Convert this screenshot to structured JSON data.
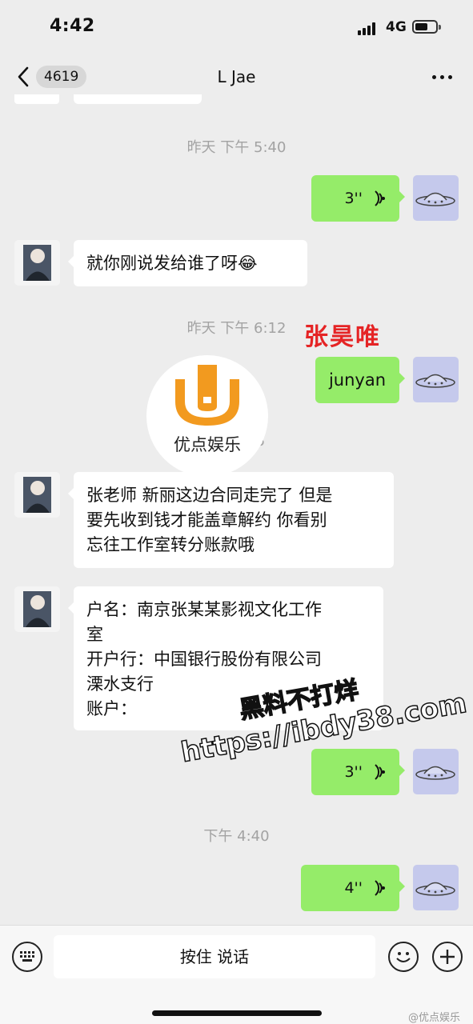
{
  "status_bar": {
    "time": "4:42",
    "network": "4G"
  },
  "header": {
    "unread_count": "4619",
    "title": "L Jae"
  },
  "messages": {
    "ts1": "昨天 下午 5:40",
    "voice1": {
      "duration": "3''"
    },
    "in1": "就你刚说发给谁了呀😂",
    "ts2": "昨天 下午 6:12",
    "out_text": "junyan",
    "ts3_partial": "5",
    "in2": [
      "张老师 新丽这边合同走完了 但是",
      "要先收到钱才能盖章解约 你看别",
      "忘往工作室转分账款哦"
    ],
    "in3": [
      "户名：南京张某某影视文化工作",
      "室",
      "开户行：中国银行股份有限公司",
      "溧水支行",
      "账户："
    ],
    "voice2": {
      "duration": "3''"
    },
    "ts4": "下午 4:40",
    "voice3": {
      "duration": "4''"
    }
  },
  "overlays": {
    "red_name": "张昊唯",
    "logo_text": "优点娱乐",
    "watermark_line1": "黑料不打烊",
    "watermark_line2": "https://ibdy38.com",
    "weibo_credit": "@优点娱乐"
  },
  "input_bar": {
    "hold_to_talk": "按住 说话"
  },
  "colors": {
    "outgoing": "#95ec69",
    "incoming": "#ffffff",
    "background": "#ededed",
    "accent_red": "#e52425",
    "logo_orange": "#f29a1f"
  },
  "icons": [
    "back-chevron-icon",
    "more-dots-icon",
    "voice-wave-icon",
    "keyboard-icon",
    "emoji-icon",
    "plus-icon"
  ]
}
